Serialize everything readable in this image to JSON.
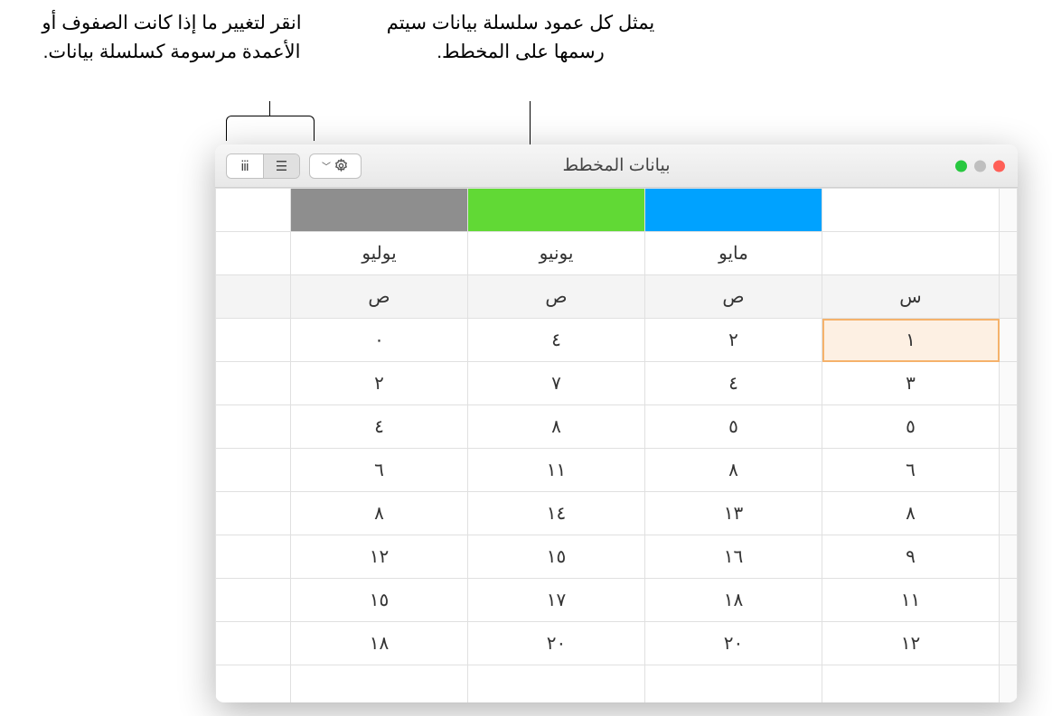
{
  "annotations": {
    "series_hint": "يمثل كل عمود سلسلة بيانات سيتم رسمها على المخطط.",
    "toggle_hint": "انقر لتغيير ما إذا كانت الصفوف أو الأعمدة مرسومة كسلسلة بيانات."
  },
  "window": {
    "title": "بيانات المخطط"
  },
  "columns": {
    "series": [
      {
        "label": "مايو",
        "color": "blue",
        "axis": "ص"
      },
      {
        "label": "يونيو",
        "color": "green",
        "axis": "ص"
      },
      {
        "label": "يوليو",
        "color": "gray",
        "axis": "ص"
      }
    ],
    "x_axis_label": "س"
  },
  "rows": [
    {
      "x": "١",
      "v": [
        "٢",
        "٤",
        "٠"
      ]
    },
    {
      "x": "٣",
      "v": [
        "٤",
        "٧",
        "٢"
      ]
    },
    {
      "x": "٥",
      "v": [
        "٥",
        "٨",
        "٤"
      ]
    },
    {
      "x": "٦",
      "v": [
        "٨",
        "١١",
        "٦"
      ]
    },
    {
      "x": "٨",
      "v": [
        "١٣",
        "١٤",
        "٨"
      ]
    },
    {
      "x": "٩",
      "v": [
        "١٦",
        "١٥",
        "١٢"
      ]
    },
    {
      "x": "١١",
      "v": [
        "١٨",
        "١٧",
        "١٥"
      ]
    },
    {
      "x": "١٢",
      "v": [
        "٢٠",
        "٢٠",
        "١٨"
      ]
    }
  ],
  "selected_cell": {
    "row": 0,
    "col": "x"
  }
}
